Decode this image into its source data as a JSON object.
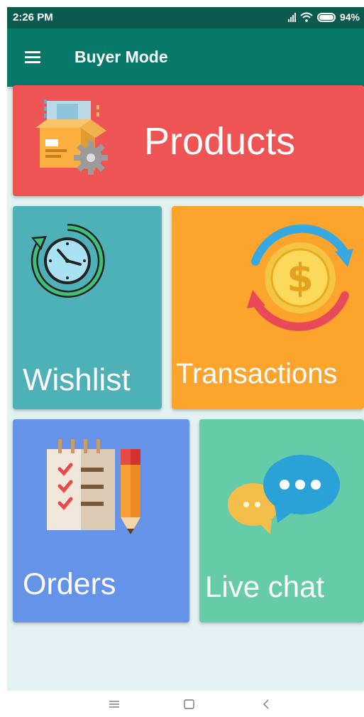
{
  "status_bar": {
    "time": "2:26 PM",
    "battery": "94%"
  },
  "app_bar": {
    "title": "Buyer Mode",
    "menu_icon": "hamburger-menu-icon"
  },
  "tiles": {
    "products": {
      "label": "Products",
      "icon": "package-gear-icon",
      "color": "#ef5454"
    },
    "wishlist": {
      "label": "Wishlist",
      "icon": "clock-history-icon",
      "color": "#4eb1b8"
    },
    "transactions": {
      "label": "Transactions",
      "icon": "dollar-coin-exchange-icon",
      "color": "#fda42c"
    },
    "orders": {
      "label": "Orders",
      "icon": "checklist-pencil-icon",
      "color": "#6593e7"
    },
    "live_chat": {
      "label": "Live chat",
      "icon": "chat-bubbles-icon",
      "color": "#66cba7"
    }
  },
  "nav_bar": {
    "menu_icon": "recents-icon",
    "home_icon": "home-square-icon",
    "back_icon": "back-chevron-icon"
  }
}
